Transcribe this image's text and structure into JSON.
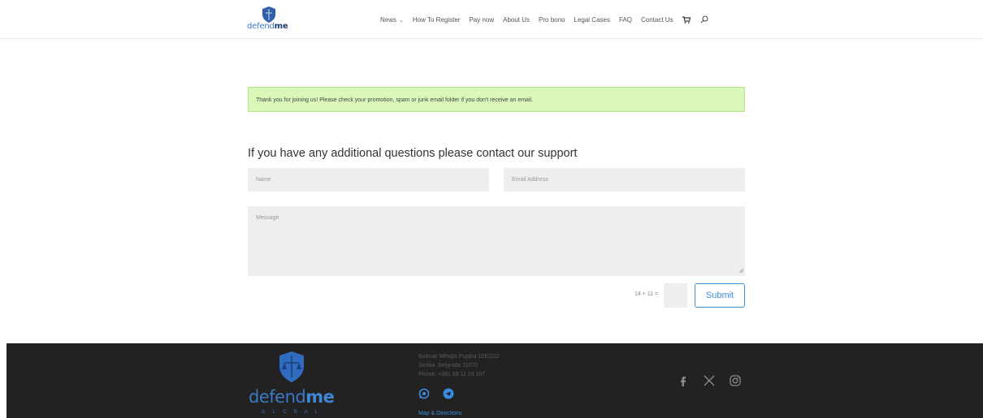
{
  "header": {
    "logo": {
      "word_light": "defend",
      "word_bold": "me"
    },
    "nav": [
      {
        "label": "News",
        "has_caret": true
      },
      {
        "label": "How To Register"
      },
      {
        "label": "Pay now"
      },
      {
        "label": "About Us"
      },
      {
        "label": "Pro bono"
      },
      {
        "label": "Legal Cases"
      },
      {
        "label": "FAQ"
      },
      {
        "label": "Contact Us"
      }
    ],
    "icons": [
      "cart-icon",
      "search-icon"
    ]
  },
  "alert": {
    "text": "Thank you for joining us! Please check your promotion, spam or junk email folder if you don't receive an email."
  },
  "contact": {
    "heading": "If you have any additional questions please contact our support",
    "name_placeholder": "Name",
    "email_placeholder": "Email Address",
    "message_placeholder": "Message",
    "captcha": "14 + 11 =",
    "submit_label": "Submit"
  },
  "footer": {
    "logo": {
      "word_light": "defend",
      "word_bold": "me",
      "sub": "GLOBAL"
    },
    "address": {
      "line1": "Bulevar Mihajla Pupina 10E/222",
      "line2": "Serbia, Belgrade 11070",
      "line3": "Phone: +381 69 11 19 107"
    },
    "messengers": [
      "whatsapp-icon",
      "telegram-icon"
    ],
    "map_link": "Map & Directions",
    "social": [
      "facebook-icon",
      "x-icon",
      "instagram-icon"
    ]
  },
  "colors": {
    "accent": "#3b8de0",
    "alert_bg": "#d9f7b8",
    "footer_bg": "#222222"
  }
}
